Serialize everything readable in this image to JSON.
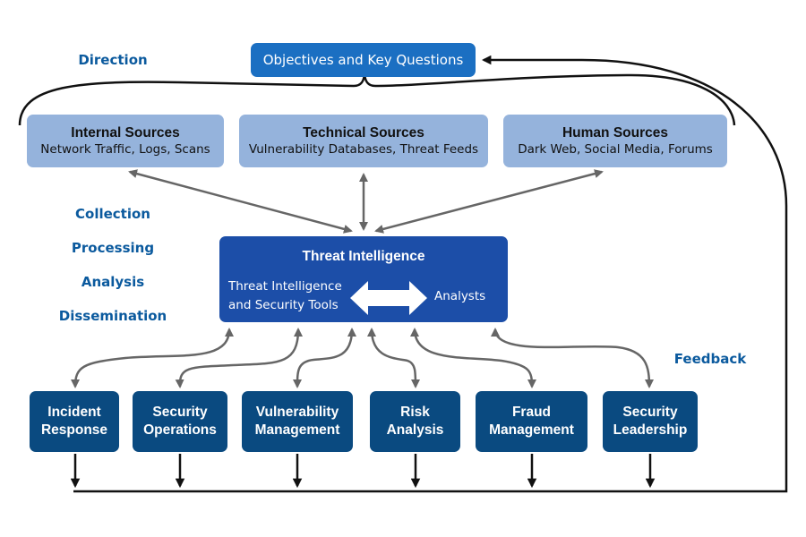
{
  "stages": {
    "direction": "Direction",
    "collection": "Collection",
    "processing": "Processing",
    "analysis": "Analysis",
    "dissemination": "Dissemination",
    "feedback": "Feedback"
  },
  "objectives": {
    "label": "Objectives and Key Questions"
  },
  "sources": [
    {
      "title": "Internal Sources",
      "subtitle": "Network Traffic, Logs, Scans"
    },
    {
      "title": "Technical Sources",
      "subtitle": "Vulnerability Databases, Threat Feeds"
    },
    {
      "title": "Human Sources",
      "subtitle": "Dark Web, Social Media, Forums"
    }
  ],
  "threat_intelligence": {
    "title": "Threat Intelligence",
    "tools_line1": "Threat Intelligence",
    "tools_line2": "and Security Tools",
    "analysts": "Analysts"
  },
  "consumers": [
    {
      "line1": "Incident",
      "line2": "Response"
    },
    {
      "line1": "Security",
      "line2": "Operations"
    },
    {
      "line1": "Vulnerability",
      "line2": "Management"
    },
    {
      "line1": "Risk",
      "line2": "Analysis"
    },
    {
      "line1": "Fraud",
      "line2": "Management"
    },
    {
      "line1": "Security",
      "line2": "Leadership"
    }
  ],
  "colors": {
    "stage_text": "#0b5a9e",
    "objectives_fill": "#1b6fc2",
    "source_fill": "#95b3dc",
    "ti_fill": "#1c4ea8",
    "consumer_fill": "#0a4a80",
    "gray_arrow": "#666666",
    "black_line": "#111111"
  }
}
